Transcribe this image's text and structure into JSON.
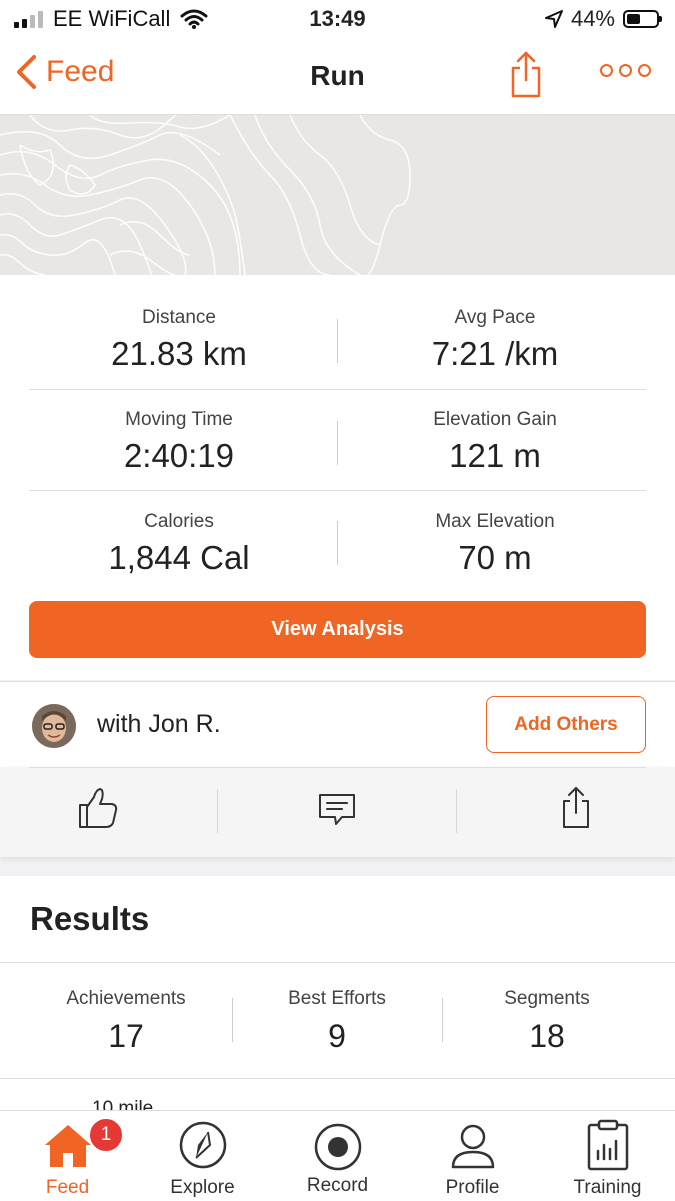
{
  "status_bar": {
    "carrier": "EE WiFiCall",
    "time": "13:49",
    "battery": "44%"
  },
  "nav": {
    "back_label": "Feed",
    "title": "Run"
  },
  "stats": [
    {
      "label": "Distance",
      "value": "21.83 km"
    },
    {
      "label": "Avg Pace",
      "value": "7:21 /km"
    },
    {
      "label": "Moving Time",
      "value": "2:40:19"
    },
    {
      "label": "Elevation Gain",
      "value": "121 m"
    },
    {
      "label": "Calories",
      "value": "1,844 Cal"
    },
    {
      "label": "Max Elevation",
      "value": "70 m"
    }
  ],
  "analysis_button": "View Analysis",
  "with_section": {
    "text": "with Jon R.",
    "add_button": "Add Others"
  },
  "results": {
    "title": "Results",
    "items": [
      {
        "label": "Achievements",
        "value": "17"
      },
      {
        "label": "Best Efforts",
        "value": "9"
      },
      {
        "label": "Segments",
        "value": "18"
      }
    ],
    "peek_text": "10 mile"
  },
  "tabbar": {
    "badge": "1",
    "tabs": [
      {
        "label": "Feed",
        "icon": "home-icon"
      },
      {
        "label": "Explore",
        "icon": "compass-icon"
      },
      {
        "label": "Record",
        "icon": "record-icon"
      },
      {
        "label": "Profile",
        "icon": "profile-icon"
      },
      {
        "label": "Training",
        "icon": "clipboard-chart-icon"
      }
    ]
  },
  "colors": {
    "accent": "#f06424",
    "badge": "#e53935",
    "map_bg": "#e9e7e3"
  }
}
